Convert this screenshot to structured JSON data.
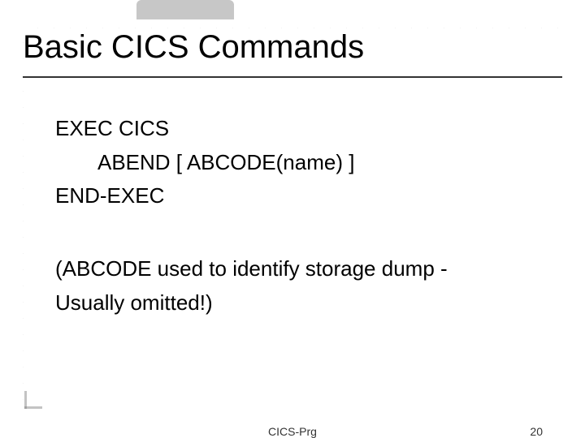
{
  "title": "Basic CICS Commands",
  "body": {
    "line1": "EXEC CICS",
    "line2": "ABEND [ ABCODE(name) ]",
    "line3": "END-EXEC",
    "line4": "(ABCODE used to identify storage dump -",
    "line5": "Usually omitted!)"
  },
  "footer": {
    "center": "CICS-Prg",
    "page": "20"
  }
}
